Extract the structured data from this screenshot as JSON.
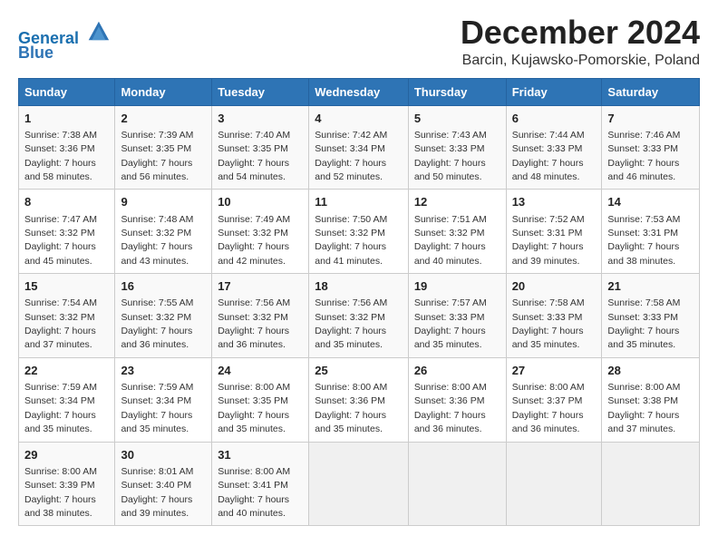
{
  "logo": {
    "line1": "General",
    "line2": "Blue"
  },
  "title": "December 2024",
  "location": "Barcin, Kujawsko-Pomorskie, Poland",
  "days_of_week": [
    "Sunday",
    "Monday",
    "Tuesday",
    "Wednesday",
    "Thursday",
    "Friday",
    "Saturday"
  ],
  "weeks": [
    [
      {
        "day": 1,
        "sunrise": "7:38 AM",
        "sunset": "3:36 PM",
        "daylight": "7 hours and 58 minutes."
      },
      {
        "day": 2,
        "sunrise": "7:39 AM",
        "sunset": "3:35 PM",
        "daylight": "7 hours and 56 minutes."
      },
      {
        "day": 3,
        "sunrise": "7:40 AM",
        "sunset": "3:35 PM",
        "daylight": "7 hours and 54 minutes."
      },
      {
        "day": 4,
        "sunrise": "7:42 AM",
        "sunset": "3:34 PM",
        "daylight": "7 hours and 52 minutes."
      },
      {
        "day": 5,
        "sunrise": "7:43 AM",
        "sunset": "3:33 PM",
        "daylight": "7 hours and 50 minutes."
      },
      {
        "day": 6,
        "sunrise": "7:44 AM",
        "sunset": "3:33 PM",
        "daylight": "7 hours and 48 minutes."
      },
      {
        "day": 7,
        "sunrise": "7:46 AM",
        "sunset": "3:33 PM",
        "daylight": "7 hours and 46 minutes."
      }
    ],
    [
      {
        "day": 8,
        "sunrise": "7:47 AM",
        "sunset": "3:32 PM",
        "daylight": "7 hours and 45 minutes."
      },
      {
        "day": 9,
        "sunrise": "7:48 AM",
        "sunset": "3:32 PM",
        "daylight": "7 hours and 43 minutes."
      },
      {
        "day": 10,
        "sunrise": "7:49 AM",
        "sunset": "3:32 PM",
        "daylight": "7 hours and 42 minutes."
      },
      {
        "day": 11,
        "sunrise": "7:50 AM",
        "sunset": "3:32 PM",
        "daylight": "7 hours and 41 minutes."
      },
      {
        "day": 12,
        "sunrise": "7:51 AM",
        "sunset": "3:32 PM",
        "daylight": "7 hours and 40 minutes."
      },
      {
        "day": 13,
        "sunrise": "7:52 AM",
        "sunset": "3:31 PM",
        "daylight": "7 hours and 39 minutes."
      },
      {
        "day": 14,
        "sunrise": "7:53 AM",
        "sunset": "3:31 PM",
        "daylight": "7 hours and 38 minutes."
      }
    ],
    [
      {
        "day": 15,
        "sunrise": "7:54 AM",
        "sunset": "3:32 PM",
        "daylight": "7 hours and 37 minutes."
      },
      {
        "day": 16,
        "sunrise": "7:55 AM",
        "sunset": "3:32 PM",
        "daylight": "7 hours and 36 minutes."
      },
      {
        "day": 17,
        "sunrise": "7:56 AM",
        "sunset": "3:32 PM",
        "daylight": "7 hours and 36 minutes."
      },
      {
        "day": 18,
        "sunrise": "7:56 AM",
        "sunset": "3:32 PM",
        "daylight": "7 hours and 35 minutes."
      },
      {
        "day": 19,
        "sunrise": "7:57 AM",
        "sunset": "3:33 PM",
        "daylight": "7 hours and 35 minutes."
      },
      {
        "day": 20,
        "sunrise": "7:58 AM",
        "sunset": "3:33 PM",
        "daylight": "7 hours and 35 minutes."
      },
      {
        "day": 21,
        "sunrise": "7:58 AM",
        "sunset": "3:33 PM",
        "daylight": "7 hours and 35 minutes."
      }
    ],
    [
      {
        "day": 22,
        "sunrise": "7:59 AM",
        "sunset": "3:34 PM",
        "daylight": "7 hours and 35 minutes."
      },
      {
        "day": 23,
        "sunrise": "7:59 AM",
        "sunset": "3:34 PM",
        "daylight": "7 hours and 35 minutes."
      },
      {
        "day": 24,
        "sunrise": "8:00 AM",
        "sunset": "3:35 PM",
        "daylight": "7 hours and 35 minutes."
      },
      {
        "day": 25,
        "sunrise": "8:00 AM",
        "sunset": "3:36 PM",
        "daylight": "7 hours and 35 minutes."
      },
      {
        "day": 26,
        "sunrise": "8:00 AM",
        "sunset": "3:36 PM",
        "daylight": "7 hours and 36 minutes."
      },
      {
        "day": 27,
        "sunrise": "8:00 AM",
        "sunset": "3:37 PM",
        "daylight": "7 hours and 36 minutes."
      },
      {
        "day": 28,
        "sunrise": "8:00 AM",
        "sunset": "3:38 PM",
        "daylight": "7 hours and 37 minutes."
      }
    ],
    [
      {
        "day": 29,
        "sunrise": "8:00 AM",
        "sunset": "3:39 PM",
        "daylight": "7 hours and 38 minutes."
      },
      {
        "day": 30,
        "sunrise": "8:01 AM",
        "sunset": "3:40 PM",
        "daylight": "7 hours and 39 minutes."
      },
      {
        "day": 31,
        "sunrise": "8:00 AM",
        "sunset": "3:41 PM",
        "daylight": "7 hours and 40 minutes."
      },
      null,
      null,
      null,
      null
    ]
  ],
  "labels": {
    "sunrise": "Sunrise: ",
    "sunset": "Sunset: ",
    "daylight": "Daylight: "
  }
}
